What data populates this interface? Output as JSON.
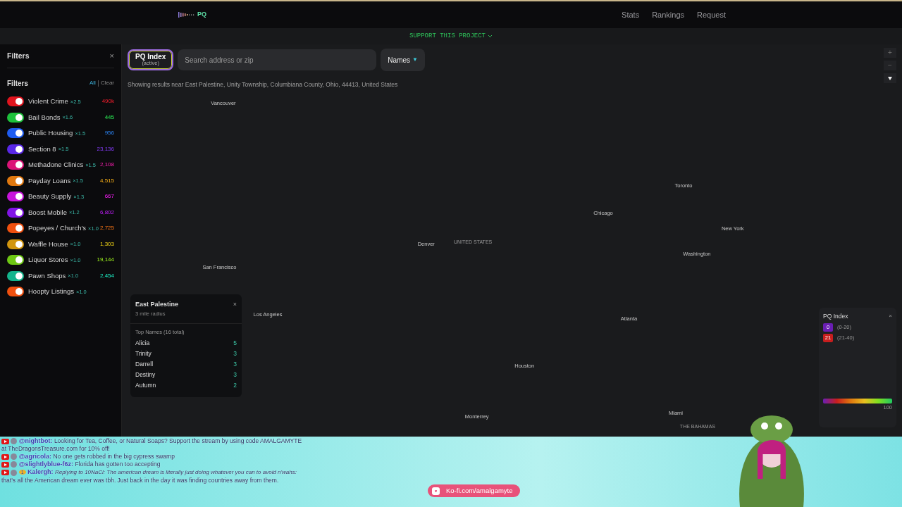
{
  "navbar": {
    "logo": "PQ",
    "links": [
      "Stats",
      "Rankings",
      "Request"
    ]
  },
  "support_bar": {
    "label": "SUPPORT THIS PROJECT"
  },
  "sidebar": {
    "title": "Filters",
    "close": "×",
    "section_title": "Filters",
    "all": "All",
    "clear": "Clear",
    "items": [
      {
        "name": "Violent Crime",
        "multiplier": "×2.5",
        "count": "490k",
        "color": "#e0141e",
        "on": true
      },
      {
        "name": "Bail Bonds",
        "multiplier": "×1.6",
        "count": "445",
        "color": "#1ec23c",
        "on": true
      },
      {
        "name": "Public Housing",
        "multiplier": "×1.5",
        "count": "956",
        "color": "#1e5cf0",
        "on": true
      },
      {
        "name": "Section 8",
        "multiplier": "×1.5",
        "count": "23,136",
        "color": "#5a28e8",
        "on": true
      },
      {
        "name": "Methadone Clinics",
        "multiplier": "×1.5",
        "count": "2,108",
        "color": "#dc1478",
        "on": true
      },
      {
        "name": "Payday Loans",
        "multiplier": "×1.5",
        "count": "4,515",
        "color": "#e0780f",
        "on": true
      },
      {
        "name": "Beauty Supply",
        "multiplier": "×1.3",
        "count": "667",
        "color": "#c814dc",
        "on": true
      },
      {
        "name": "Boost Mobile",
        "multiplier": "×1.2",
        "count": "6,802",
        "color": "#8214e6",
        "on": true
      },
      {
        "name": "Popeyes / Church's",
        "multiplier": "×1.0",
        "count": "2,725",
        "color": "#f0500f",
        "on": true
      },
      {
        "name": "Waffle House",
        "multiplier": "×1.0",
        "count": "1,303",
        "color": "#d2960f",
        "on": true
      },
      {
        "name": "Liquor Stores",
        "multiplier": "×1.0",
        "count": "19,144",
        "color": "#6ec814",
        "on": true
      },
      {
        "name": "Pawn Shops",
        "multiplier": "×1.0",
        "count": "2,454",
        "color": "#14b48c",
        "on": true
      },
      {
        "name": "Hoopty Listings",
        "multiplier": "×1.0",
        "color": "#f0500f",
        "on": true
      }
    ]
  },
  "toolbar": {
    "index_button": "PQ Index",
    "index_status": "(active)",
    "search": {
      "placeholder": "Search address or zip"
    },
    "mode": "Names",
    "mode_caret": "▼",
    "results_note": "Showing results near East Palestine, Unity Township, Columbiana County, Ohio, 44413, United States"
  },
  "map_labels": [
    {
      "text": "Vancouver",
      "kind": "city"
    },
    {
      "text": "Toronto",
      "kind": "city"
    },
    {
      "text": "Chicago",
      "kind": "city"
    },
    {
      "text": "New York",
      "kind": "city"
    },
    {
      "text": "Denver",
      "kind": "city"
    },
    {
      "text": "UNITED STATES",
      "kind": "country"
    },
    {
      "text": "Washington",
      "kind": "city"
    },
    {
      "text": "San Francisco",
      "kind": "city"
    },
    {
      "text": "Los Angeles",
      "kind": "city"
    },
    {
      "text": "Atlanta",
      "kind": "city"
    },
    {
      "text": "Houston",
      "kind": "city"
    },
    {
      "text": "Monterrey",
      "kind": "city"
    },
    {
      "text": "Miami",
      "kind": "city"
    },
    {
      "text": "THE BAHAMAS",
      "kind": "country"
    }
  ],
  "map_controls": [
    "+",
    "−"
  ],
  "popup": {
    "title": "East Palestine",
    "subtitle": "3 mile radius",
    "close": "×",
    "heading": "Top Names (16 total)",
    "names": [
      {
        "name": "Alicia",
        "count": "5"
      },
      {
        "name": "Trinity",
        "count": "3"
      },
      {
        "name": "Darrell",
        "count": "3"
      },
      {
        "name": "Destiny",
        "count": "3"
      },
      {
        "name": "Autumn",
        "count": "2"
      }
    ]
  },
  "legend": {
    "title": "PQ Index",
    "close": "×",
    "items": [
      {
        "badge": "0",
        "range": "(0-20)",
        "color": "#6a1eb4"
      },
      {
        "badge": "21",
        "range": "(21-40)",
        "color": "#c81e1e"
      }
    ],
    "max": "100"
  },
  "chat": [
    {
      "user": "@nightbot:",
      "text": "Looking for Tea, Coffee, or Natural Soaps? Support the stream by using code AMALGAMYTE at TheDragonsTreasure.com for 10% off!"
    },
    {
      "user": "@agricola:",
      "text": "No one gets robbed in the big cypress swamp"
    },
    {
      "user": "@slightlyblue-f6z:",
      "text": "Florida has gotten too accepting"
    },
    {
      "user": "Kalergh:",
      "reply": "Replying to 10NaCl: The american dream is literally just doing whatever you can to avoid n'wahs:",
      "text": "that's all the American dream ever was tbh. Just back in the day it was finding countries away from them.",
      "badge": "1"
    }
  ],
  "kofi": "Ko-fi.com/amalgamyte"
}
